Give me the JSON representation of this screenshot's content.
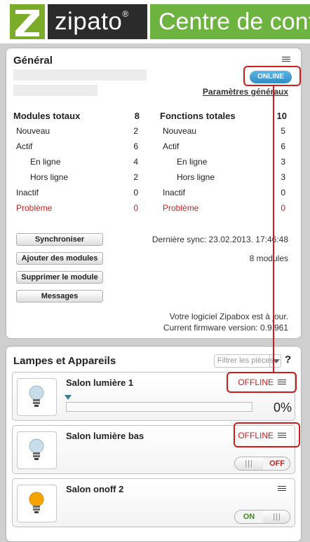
{
  "header": {
    "brand": "zipato",
    "trademark": "®",
    "title": "Centre de contrôle"
  },
  "general": {
    "title": "Général",
    "status": "ONLINE",
    "params_link": "Paramètres généraux",
    "modules": {
      "title": "Modules totaux",
      "total": "8",
      "rows": [
        {
          "label": "Nouveau",
          "value": "2"
        },
        {
          "label": "Actif",
          "value": "6"
        },
        {
          "label": "En ligne",
          "value": "4"
        },
        {
          "label": "Hors ligne",
          "value": "2"
        },
        {
          "label": "Inactif",
          "value": "0"
        },
        {
          "label": "Problème",
          "value": "0"
        }
      ]
    },
    "functions": {
      "title": "Fonctions totales",
      "total": "10",
      "rows": [
        {
          "label": "Nouveau",
          "value": "5"
        },
        {
          "label": "Actif",
          "value": "6"
        },
        {
          "label": "En ligne",
          "value": "3"
        },
        {
          "label": "Hors ligne",
          "value": "3"
        },
        {
          "label": "Inactif",
          "value": "0"
        },
        {
          "label": "Problème",
          "value": "0"
        }
      ]
    },
    "buttons": {
      "sync": "Synchroniser",
      "add_module": "Ajouter des modules",
      "remove_module": "Supprimer le module",
      "messages": "Messages"
    },
    "last_sync": "Dernière sync: 23.02.2013. 17:46:48",
    "module_count": "8 modules",
    "software_status": "Votre logiciel Zipabox est à jour.",
    "firmware": "Current firmware version: 0.9.961"
  },
  "lamps": {
    "title": "Lampes et Appareils",
    "filter_placeholder": "Filtrer les pièces",
    "help": "?",
    "devices": [
      {
        "name": "Salon lumière 1",
        "status": "OFFLINE",
        "dimmer_percent": "0%",
        "dimmer_level": 0
      },
      {
        "name": "Salon lumière bas",
        "status": "OFFLINE",
        "toggle_label": "OFF",
        "toggle_state": "off"
      },
      {
        "name": "Salon onoff 2",
        "status": "",
        "toggle_label": "ON",
        "toggle_state": "on"
      }
    ],
    "toggle_grip": "|||"
  },
  "colors": {
    "brand_green": "#6cb33f",
    "logo_dark": "#2b2b2b",
    "online_blue": "#2d8cc4",
    "offline_red": "#cc1f1f",
    "annotation_red": "#d21a1a",
    "on_green": "#3d8a1f",
    "bulb_lit": "#f5a400",
    "bulb_unlit": "#c7dde8"
  },
  "icons": [
    "zipato-z-logo",
    "menu-list-icon",
    "bulb-off-icon",
    "bulb-on-icon",
    "dropdown-arrow-icon",
    "help-icon",
    "slider-thumb-icon"
  ]
}
